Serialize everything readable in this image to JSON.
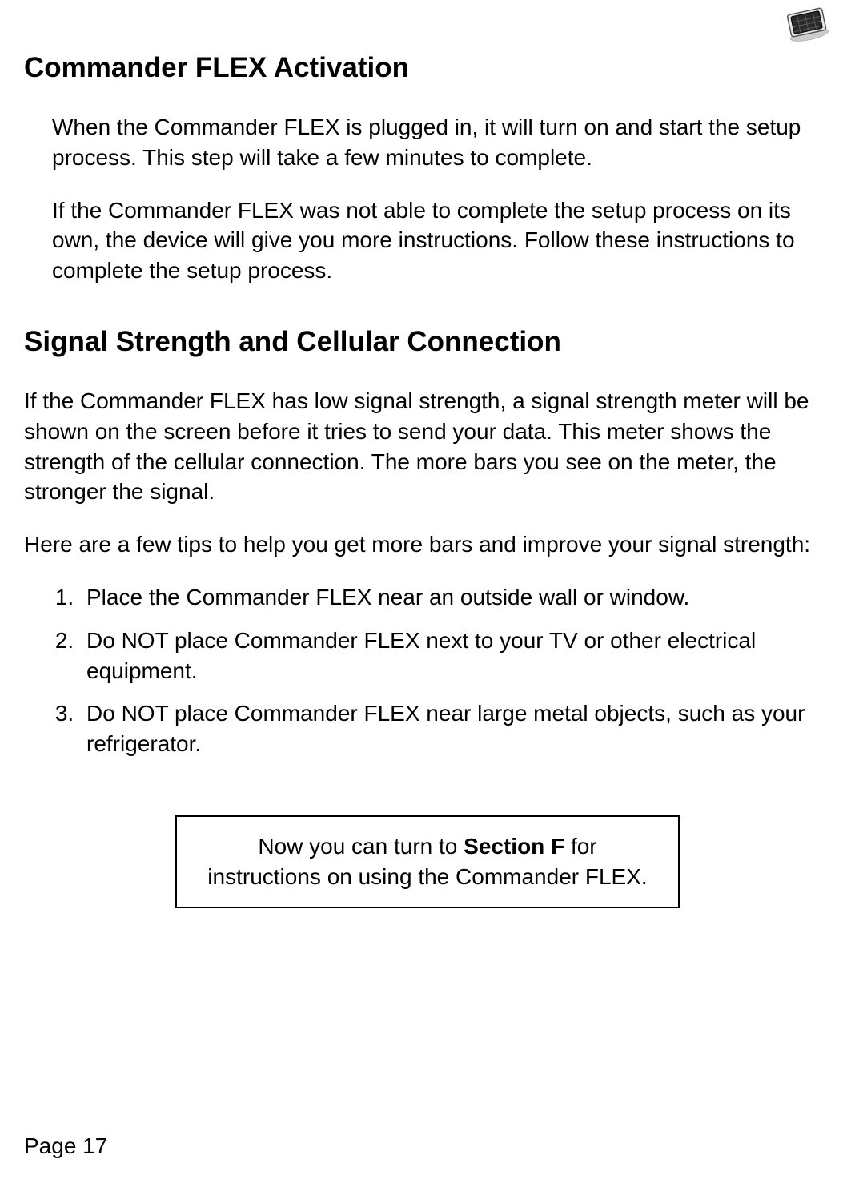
{
  "header": {
    "icon_name": "device-icon"
  },
  "section1": {
    "heading": "Commander FLEX Activation",
    "para1": "When the Commander FLEX is plugged in, it will turn on and start the setup process.  This step will take a few minutes to complete.",
    "para2": "If the Commander FLEX was not able to complete the setup process on its own, the device will give you more instructions.  Follow these instructions to complete the setup process."
  },
  "section2": {
    "heading": "Signal Strength and Cellular Connection",
    "para1": "If the Commander FLEX has low signal strength, a signal strength meter will be shown on the screen before it tries to send your data.  This meter shows the strength of the cellular connection.  The more bars you see on the meter, the stronger the signal.",
    "para2": "Here are a few tips to help you get more bars and improve your signal strength:",
    "tips": [
      "Place the Commander FLEX near an outside wall or window.",
      "Do NOT place Commander FLEX next to your TV or other electrical equipment.",
      "Do NOT place Commander FLEX near large metal objects, such as your refrigerator."
    ]
  },
  "callout": {
    "pre": "Now you can turn to ",
    "bold": "Section F",
    "post": " for instructions on using the Commander FLEX."
  },
  "footer": {
    "page_label": "Page 17"
  }
}
